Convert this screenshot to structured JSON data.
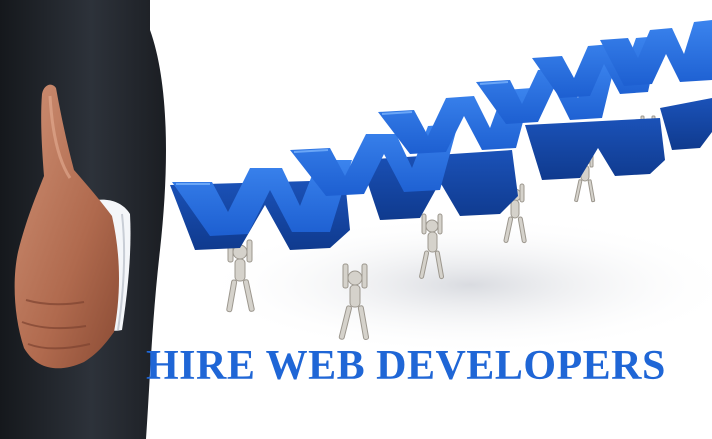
{
  "headline": {
    "text": "HIRE WEB DEVELOPERS",
    "color": "#1f66d6"
  },
  "illustration": {
    "letters": [
      "W",
      "W",
      "W"
    ],
    "letter_color": "#1d5fd1",
    "icons": [
      "handshake-icon",
      "figure-icon"
    ]
  },
  "colors": {
    "suit": "#1f2328",
    "shirt": "#f4f6f9",
    "skin": "#b9785d",
    "figure": "#d5d2cb",
    "shadow": "#e2e3e6"
  }
}
